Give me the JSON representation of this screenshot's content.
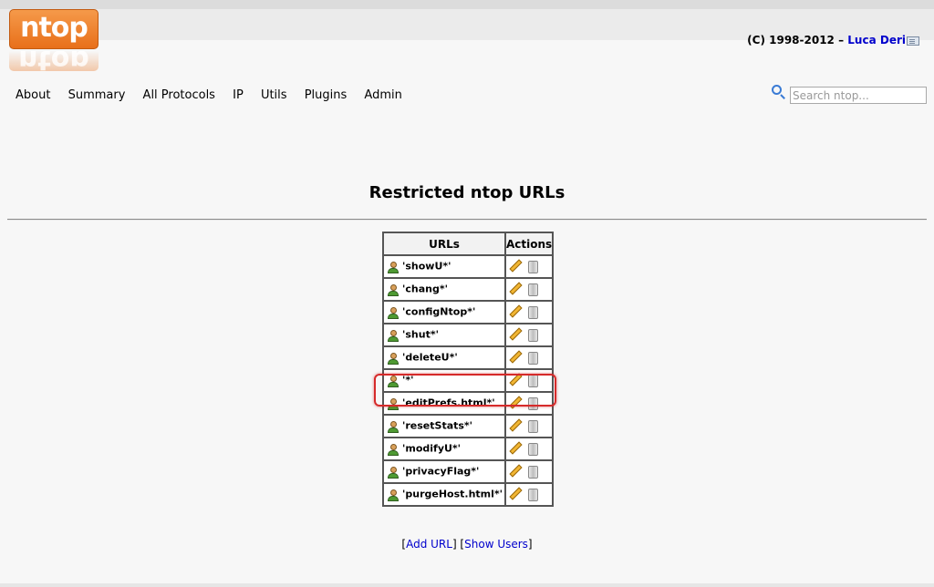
{
  "header": {
    "logo_text": "ntop",
    "copyright_prefix": "(C) 1998-2012 –",
    "author_link": "Luca Deri"
  },
  "nav": {
    "items": [
      "About",
      "Summary",
      "All Protocols",
      "IP",
      "Utils",
      "Plugins",
      "Admin"
    ]
  },
  "search": {
    "placeholder": "Search ntop..."
  },
  "page": {
    "title": "Restricted ntop URLs"
  },
  "table": {
    "headers": [
      "URLs",
      "Actions"
    ],
    "rows": [
      "'showU*'",
      "'chang*'",
      "'configNtop*'",
      "'shut*'",
      "'deleteU*'",
      "'*'",
      "'editPrefs.html*'",
      "'resetStats*'",
      "'modifyU*'",
      "'privacyFlag*'",
      "'purgeHost.html*'"
    ],
    "highlighted_row": "'*'"
  },
  "footer_links": {
    "open": "[",
    "add_url": "Add URL",
    "separator": "] [",
    "show_users": "Show Users",
    "close": "]"
  },
  "icons": {
    "row": "user-icon",
    "edit": "pencil-icon",
    "delete": "trash-icon",
    "search": "search-icon",
    "mail": "mail-icon"
  },
  "colors": {
    "logo": "#e8701a",
    "link": "#0000cc",
    "highlight": "#d62a2a"
  }
}
